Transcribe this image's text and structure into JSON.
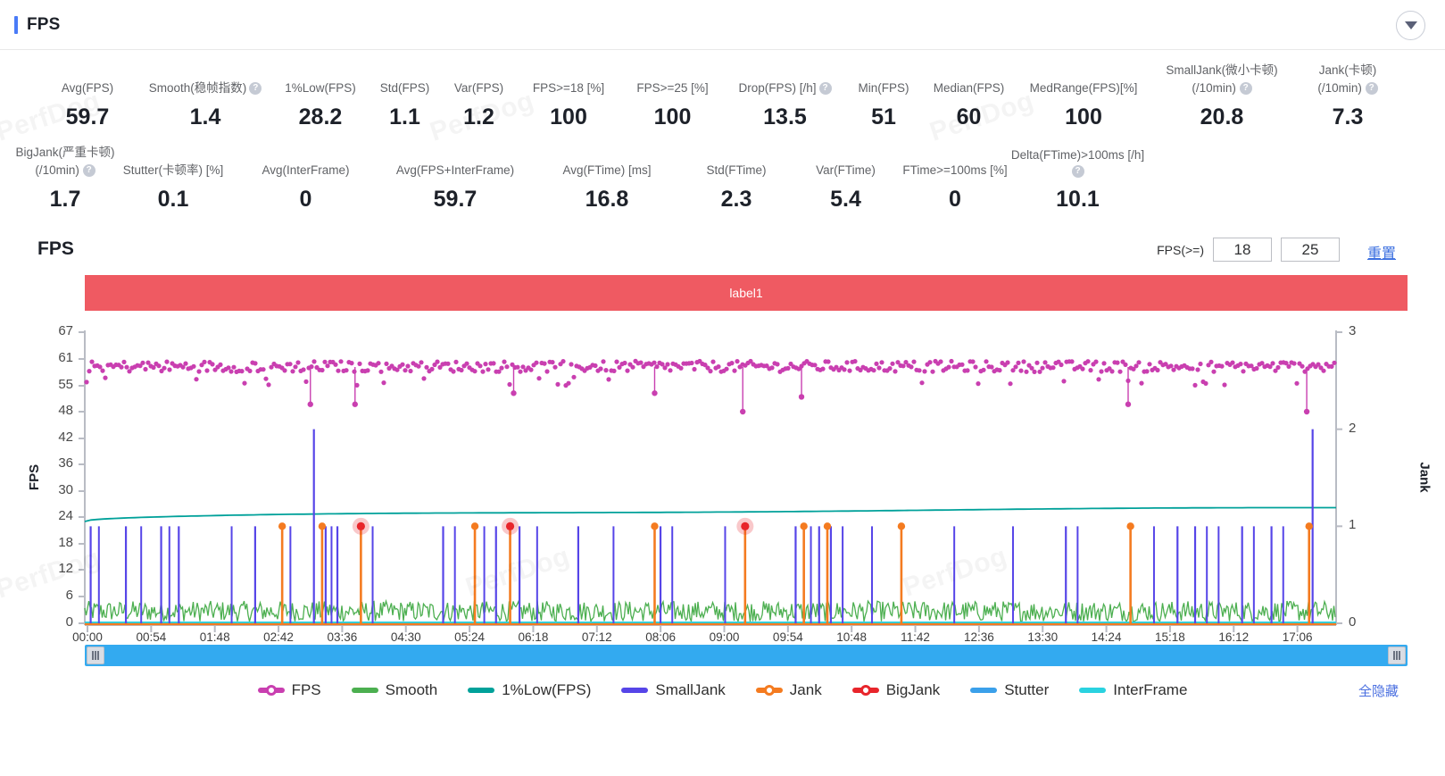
{
  "header": {
    "title": "FPS",
    "collapse_icon": "chevron-down-icon"
  },
  "metrics_row1": [
    {
      "label": "Avg(FPS)",
      "value": "59.7",
      "help": false
    },
    {
      "label": "Smooth(稳帧指数)",
      "value": "1.4",
      "help": true
    },
    {
      "label": "1%Low(FPS)",
      "value": "28.2",
      "help": false
    },
    {
      "label": "Std(FPS)",
      "value": "1.1",
      "help": false
    },
    {
      "label": "Var(FPS)",
      "value": "1.2",
      "help": false
    },
    {
      "label": "FPS>=18 [%]",
      "value": "100",
      "help": false
    },
    {
      "label": "FPS>=25 [%]",
      "value": "100",
      "help": false
    },
    {
      "label": "Drop(FPS) [/h]",
      "value": "13.5",
      "help": true
    },
    {
      "label": "Min(FPS)",
      "value": "51",
      "help": false
    },
    {
      "label": "Median(FPS)",
      "value": "60",
      "help": false
    },
    {
      "label": "MedRange(FPS)[%]",
      "value": "100",
      "help": false
    },
    {
      "label": "SmallJank(微小卡顿)",
      "label2": "(/10min)",
      "value": "20.8",
      "help": true
    },
    {
      "label": "Jank(卡顿)",
      "label2": "(/10min)",
      "value": "7.3",
      "help": true
    }
  ],
  "metrics_row2": [
    {
      "label": "BigJank(严重卡顿)",
      "label2": "(/10min)",
      "value": "1.7",
      "help": true
    },
    {
      "label": "Stutter(卡顿率) [%]",
      "value": "0.1",
      "help": false
    },
    {
      "label": "Avg(InterFrame)",
      "value": "0",
      "help": false
    },
    {
      "label": "Avg(FPS+InterFrame)",
      "value": "59.7",
      "help": false
    },
    {
      "label": "Avg(FTime) [ms]",
      "value": "16.8",
      "help": false
    },
    {
      "label": "Std(FTime)",
      "value": "2.3",
      "help": false
    },
    {
      "label": "Var(FTime)",
      "value": "5.4",
      "help": false
    },
    {
      "label": "FTime>=100ms [%]",
      "value": "0",
      "help": false
    },
    {
      "label": "Delta(FTime)>100ms [/h]",
      "value": "10.1",
      "help": true
    }
  ],
  "chart_header": {
    "title": "FPS",
    "threshold_label": "FPS(>=)",
    "threshold_low": "18",
    "threshold_high": "25",
    "reset_label": "重置"
  },
  "label_band": {
    "text": "label1",
    "color": "#ef5a62"
  },
  "scrollbar": {
    "left_grip": "drag-handle",
    "right_grip": "drag-handle"
  },
  "legend": {
    "items": [
      {
        "name": "FPS",
        "color": "#c93fb0",
        "marker": "dot"
      },
      {
        "name": "Smooth",
        "color": "#4caf50",
        "marker": "line"
      },
      {
        "name": "1%Low(FPS)",
        "color": "#00a19a",
        "marker": "line"
      },
      {
        "name": "SmallJank",
        "color": "#5645e8",
        "marker": "line"
      },
      {
        "name": "Jank",
        "color": "#f47b20",
        "marker": "dot"
      },
      {
        "name": "BigJank",
        "color": "#e8252b",
        "marker": "dot"
      },
      {
        "name": "Stutter",
        "color": "#3ba0ea",
        "marker": "line"
      },
      {
        "name": "InterFrame",
        "color": "#2ad2e0",
        "marker": "line"
      }
    ],
    "hide_all_label": "全隐藏"
  },
  "watermark_text": "PerfDog",
  "chart_data": {
    "type": "line",
    "title": "FPS",
    "xlabel": "",
    "ylabel": "FPS",
    "y2label": "Jank",
    "ylim": [
      0,
      67
    ],
    "y2lim": [
      0,
      3
    ],
    "yticks": [
      0,
      6,
      12,
      18,
      24,
      30,
      36,
      42,
      48,
      55,
      61,
      67
    ],
    "y2ticks": [
      0,
      1,
      2,
      3
    ],
    "xticks": [
      "00:00",
      "00:54",
      "01:48",
      "02:42",
      "03:36",
      "04:30",
      "05:24",
      "06:18",
      "07:12",
      "08:06",
      "09:00",
      "09:54",
      "10:48",
      "11:42",
      "12:36",
      "13:30",
      "14:24",
      "15:18",
      "16:12",
      "17:06"
    ],
    "grid": false,
    "legend_position": "bottom",
    "series": [
      {
        "name": "FPS",
        "color": "#c93fb0",
        "axis": "left",
        "marker": "circle",
        "description": "Dense scatter around 58-61 FPS across entire run with sparse downward spikes",
        "baseline": 59.7,
        "dips": [
          {
            "x": "03:12",
            "y": 50
          },
          {
            "x": "03:50",
            "y": 50
          },
          {
            "x": "06:05",
            "y": 53
          },
          {
            "x": "08:05",
            "y": 53
          },
          {
            "x": "09:20",
            "y": 48
          },
          {
            "x": "10:10",
            "y": 52
          },
          {
            "x": "14:48",
            "y": 50
          },
          {
            "x": "17:20",
            "y": 48
          }
        ]
      },
      {
        "name": "Smooth",
        "color": "#4caf50",
        "axis": "left",
        "description": "Low-amplitude noisy band oscillating between 0 and 5 FPS across the full timeline",
        "mean": 1.4
      },
      {
        "name": "1%Low(FPS)",
        "color": "#00a19a",
        "axis": "left",
        "description": "Smooth slowly rising curve from ~23 to ~26",
        "start": 23.0,
        "end": 26.2
      },
      {
        "name": "SmallJank",
        "color": "#5645e8",
        "axis": "right",
        "description": "Vertical impulse spikes of height 1 (and one of 2 near 03:15 and 17:20)",
        "spikes": [
          {
            "x": "00:05",
            "h": 1
          },
          {
            "x": "00:35",
            "h": 1
          },
          {
            "x": "01:05",
            "h": 1
          },
          {
            "x": "01:20",
            "h": 1
          },
          {
            "x": "02:25",
            "h": 1
          },
          {
            "x": "03:15",
            "h": 2
          },
          {
            "x": "03:25",
            "h": 1
          },
          {
            "x": "03:35",
            "h": 1
          },
          {
            "x": "05:05",
            "h": 1
          },
          {
            "x": "05:50",
            "h": 1
          },
          {
            "x": "06:10",
            "h": 1
          },
          {
            "x": "07:00",
            "h": 1
          },
          {
            "x": "08:10",
            "h": 1
          },
          {
            "x": "10:05",
            "h": 1
          },
          {
            "x": "10:25",
            "h": 1
          },
          {
            "x": "10:35",
            "h": 1
          },
          {
            "x": "13:55",
            "h": 1
          },
          {
            "x": "15:30",
            "h": 1
          },
          {
            "x": "15:45",
            "h": 1
          },
          {
            "x": "16:25",
            "h": 1
          },
          {
            "x": "16:50",
            "h": 1
          },
          {
            "x": "17:25",
            "h": 2
          }
        ]
      },
      {
        "name": "Jank",
        "color": "#f47b20",
        "axis": "right",
        "description": "Impulse spikes of height 1 with circle markers at top",
        "spikes": [
          {
            "x": "02:48",
            "h": 1
          },
          {
            "x": "03:22",
            "h": 1
          },
          {
            "x": "03:55",
            "h": 1
          },
          {
            "x": "05:32",
            "h": 1
          },
          {
            "x": "06:02",
            "h": 1
          },
          {
            "x": "08:05",
            "h": 1
          },
          {
            "x": "09:22",
            "h": 1
          },
          {
            "x": "10:12",
            "h": 1
          },
          {
            "x": "10:32",
            "h": 1
          },
          {
            "x": "11:35",
            "h": 1
          },
          {
            "x": "14:50",
            "h": 1
          },
          {
            "x": "17:22",
            "h": 1
          }
        ]
      },
      {
        "name": "BigJank",
        "color": "#e8252b",
        "axis": "right",
        "description": "Three highlighted big-jank markers at height 1",
        "spikes": [
          {
            "x": "03:55",
            "h": 1
          },
          {
            "x": "06:02",
            "h": 1
          },
          {
            "x": "09:22",
            "h": 1
          }
        ]
      },
      {
        "name": "Stutter",
        "color": "#3ba0ea",
        "axis": "right",
        "description": "Flat at 0 across the whole timeline",
        "value": 0
      },
      {
        "name": "InterFrame",
        "color": "#2ad2e0",
        "axis": "left",
        "description": "Flat at 0 across the whole timeline",
        "value": 0
      }
    ]
  }
}
